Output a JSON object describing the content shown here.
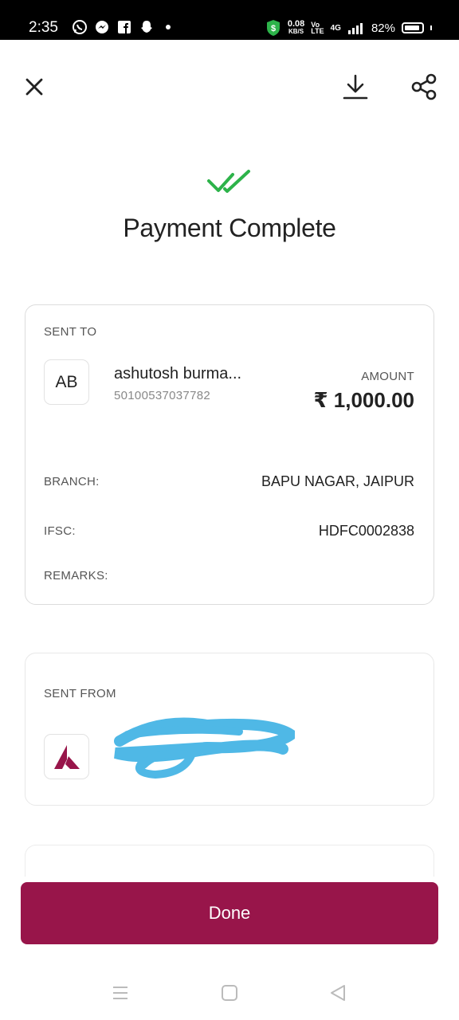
{
  "status_bar": {
    "time": "2:35",
    "net_speed": "0.08",
    "net_speed_unit": "KB/S",
    "volte_top": "Vo",
    "volte_bottom": "LTE",
    "network_type": "4G",
    "battery": "82%"
  },
  "toolbar": {
    "close_icon": "close-icon",
    "download_icon": "download-icon",
    "share_icon": "share-icon"
  },
  "header": {
    "title": "Payment Complete",
    "success_color": "#2db34a"
  },
  "sent_to": {
    "label": "SENT TO",
    "avatar_initials": "AB",
    "name": "ashutosh burma...",
    "account_number": "50100537037782",
    "amount_label": "AMOUNT",
    "amount": "₹ 1,000.00",
    "branch_label": "BRANCH:",
    "branch_value": "BAPU NAGAR, JAIPUR",
    "ifsc_label": "IFSC:",
    "ifsc_value": "HDFC0002838",
    "remarks_label": "REMARKS:"
  },
  "sent_from": {
    "label": "SENT FROM",
    "bank_logo": "axis-bank-logo",
    "redaction_color": "#4fb8e6"
  },
  "actions": {
    "done_label": "Done",
    "done_color": "#98154a"
  },
  "nav_bar": {
    "menu_icon": "menu-icon",
    "home_icon": "home-icon",
    "back_icon": "back-icon"
  }
}
